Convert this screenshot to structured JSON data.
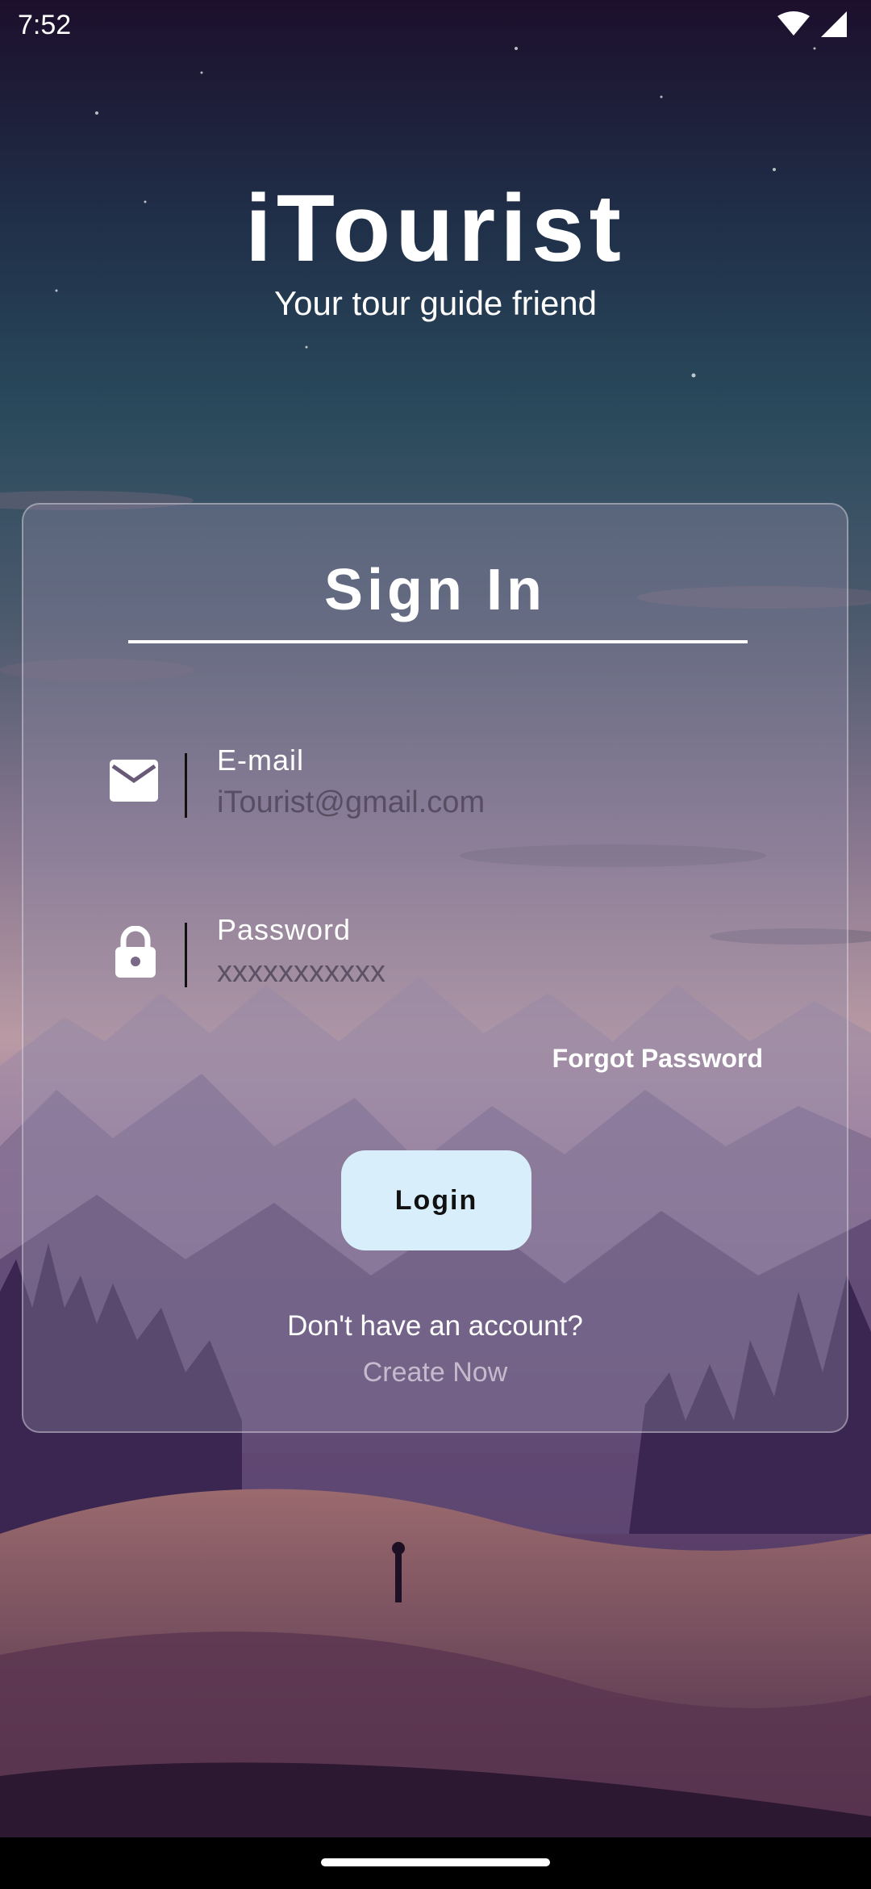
{
  "status_bar": {
    "time": "7:52",
    "wifi_icon": "wifi-icon",
    "signal_icon": "cell-signal-icon"
  },
  "header": {
    "app_title": "iTourist",
    "subtitle": "Your tour guide friend"
  },
  "signin": {
    "title": "Sign In",
    "email": {
      "label": "E-mail",
      "placeholder": "iTourist@gmail.com",
      "icon": "mail-icon"
    },
    "password": {
      "label": "Password",
      "placeholder": "xxxxxxxxxxx",
      "icon": "lock-icon"
    },
    "forgot_password": "Forgot Password",
    "login_button": "Login",
    "no_account_text": "Don't have an account?",
    "create_now": "Create Now"
  },
  "colors": {
    "login_button_bg": "#d8eefa",
    "card_bg": "rgba(150,140,170,0.35)"
  }
}
